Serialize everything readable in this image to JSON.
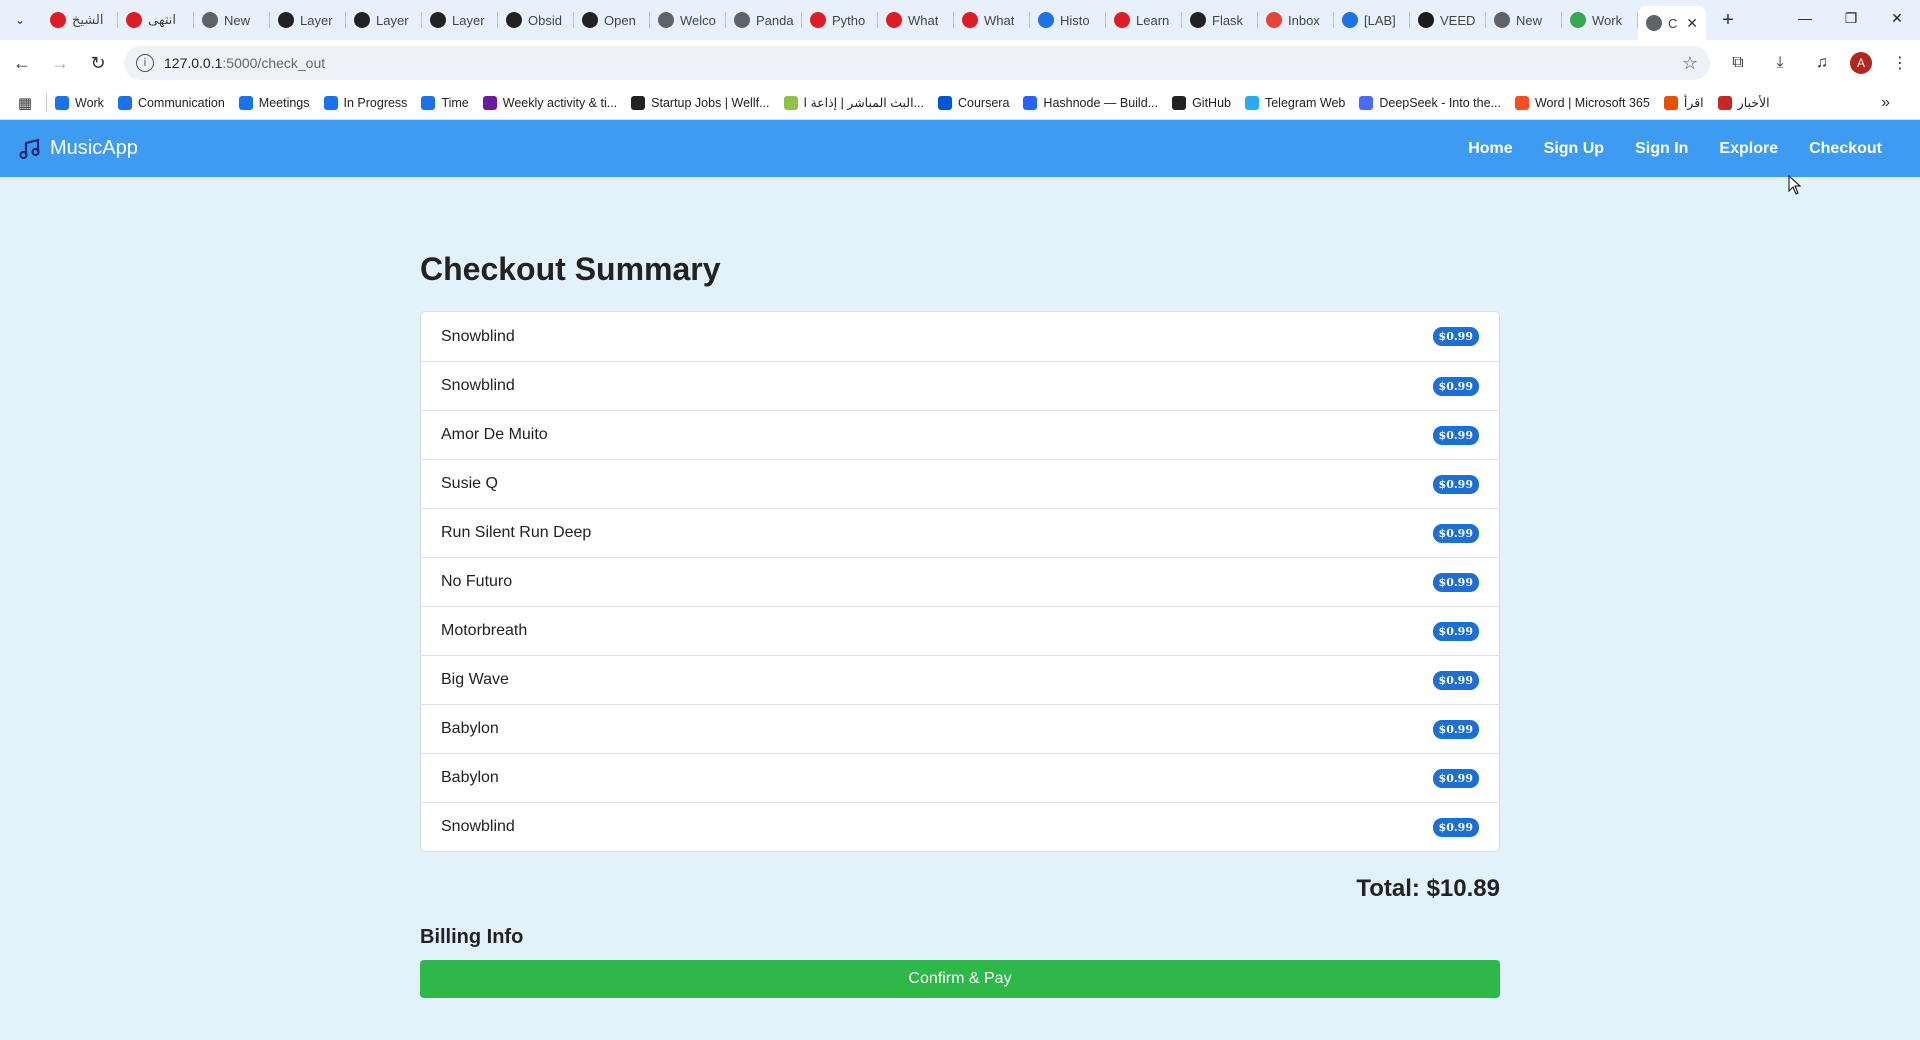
{
  "browser": {
    "tabs": [
      {
        "title": "الشيخ",
        "color": "#e01b24"
      },
      {
        "title": "انتهى",
        "color": "#e01b24"
      },
      {
        "title": "New",
        "color": "#5f6368"
      },
      {
        "title": "Layer",
        "color": "#222222"
      },
      {
        "title": "Layer",
        "color": "#222222"
      },
      {
        "title": "Layer",
        "color": "#222222"
      },
      {
        "title": "Obsid",
        "color": "#222222"
      },
      {
        "title": "Open",
        "color": "#222222"
      },
      {
        "title": "Welco",
        "color": "#5f6368"
      },
      {
        "title": "Panda",
        "color": "#5f6368"
      },
      {
        "title": "Pytho",
        "color": "#e01b24"
      },
      {
        "title": "What",
        "color": "#e01b24"
      },
      {
        "title": "What",
        "color": "#e01b24"
      },
      {
        "title": "Histo",
        "color": "#1a73e8"
      },
      {
        "title": "Learn",
        "color": "#e01b24"
      },
      {
        "title": "Flask",
        "color": "#222222"
      },
      {
        "title": "Inbox",
        "color": "#ea4335"
      },
      {
        "title": "[LAB]",
        "color": "#1a73e8"
      },
      {
        "title": "VEED",
        "color": "#1b1b1b"
      },
      {
        "title": "New",
        "color": "#5f6368"
      },
      {
        "title": "Work",
        "color": "#34a853"
      }
    ],
    "active_tab": {
      "title": "C",
      "close": "✕"
    },
    "new_tab": "+",
    "window_controls": {
      "minimize": "—",
      "restore": "❐",
      "close": "✕"
    },
    "url_host": "127.0.0.1",
    "url_path": ":5000/check_out",
    "bookmarks": [
      {
        "label": "Work",
        "color": "#1a73e8"
      },
      {
        "label": "Communication",
        "color": "#1a73e8"
      },
      {
        "label": "Meetings",
        "color": "#1a73e8"
      },
      {
        "label": "In Progress",
        "color": "#1a73e8"
      },
      {
        "label": "Time",
        "color": "#1a73e8"
      },
      {
        "label": "Weekly activity & ti...",
        "color": "#6a1b9a"
      },
      {
        "label": "Startup Jobs | Wellf...",
        "color": "#222222"
      },
      {
        "label": "البث المباشر | إذاعة ا...",
        "color": "#8bc34a"
      },
      {
        "label": "Coursera",
        "color": "#0056d2"
      },
      {
        "label": "Hashnode — Build...",
        "color": "#2962ff"
      },
      {
        "label": "GitHub",
        "color": "#222222"
      },
      {
        "label": "Telegram Web",
        "color": "#2aabee"
      },
      {
        "label": "DeepSeek - Into the...",
        "color": "#4d6bfe"
      },
      {
        "label": "Word | Microsoft 365",
        "color": "#f25022"
      },
      {
        "label": "اقرأ",
        "color": "#e65100"
      },
      {
        "label": "الأخبار",
        "color": "#c62828"
      }
    ]
  },
  "app": {
    "brand": "MusicApp",
    "nav": [
      "Home",
      "Sign Up",
      "Sign In",
      "Explore",
      "Checkout"
    ],
    "page_title": "Checkout Summary",
    "items": [
      {
        "name": "Snowblind",
        "price": "$0.99"
      },
      {
        "name": "Snowblind",
        "price": "$0.99"
      },
      {
        "name": "Amor De Muito",
        "price": "$0.99"
      },
      {
        "name": "Susie Q",
        "price": "$0.99"
      },
      {
        "name": "Run Silent Run Deep",
        "price": "$0.99"
      },
      {
        "name": "No Futuro",
        "price": "$0.99"
      },
      {
        "name": "Motorbreath",
        "price": "$0.99"
      },
      {
        "name": "Big Wave",
        "price": "$0.99"
      },
      {
        "name": "Babylon",
        "price": "$0.99"
      },
      {
        "name": "Babylon",
        "price": "$0.99"
      },
      {
        "name": "Snowblind",
        "price": "$0.99"
      }
    ],
    "total": "Total: $10.89",
    "billing_heading": "Billing Info",
    "confirm_label": "Confirm & Pay"
  },
  "colors": {
    "navbar": "#3d9bf2",
    "page_bg": "#e3f1fb",
    "price_badge": "#1d6fd6",
    "confirm_button": "#2fb84a"
  }
}
